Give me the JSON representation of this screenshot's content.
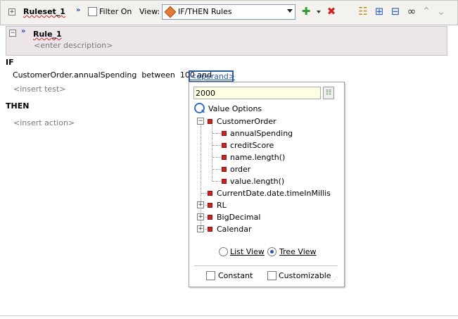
{
  "toolbar": {
    "ruleset_label": "Ruleset_1",
    "filter_label": "Filter On",
    "view_label": "View:",
    "view_value": "IF/THEN Rules"
  },
  "rule": {
    "name": "Rule_1",
    "description_placeholder": "<enter description>"
  },
  "if_label": "IF",
  "test": {
    "expression": "CustomerOrder.annualSpending  between  100 and",
    "operand": "<operand>",
    "insert_test": "<insert test>"
  },
  "then_label": "THEN",
  "insert_action": "<insert action>",
  "popup": {
    "input_value": "2000",
    "value_options_label": "Value Options",
    "tree": [
      {
        "label": "CustomerOrder",
        "expandable": true,
        "expanded": true,
        "children": [
          "annualSpending",
          "creditScore",
          "name.length()",
          "order",
          "value.length()"
        ]
      },
      {
        "label": "CurrentDate.date.timeInMillis",
        "expandable": false
      },
      {
        "label": "RL",
        "expandable": true,
        "expanded": false
      },
      {
        "label": "BigDecimal",
        "expandable": true,
        "expanded": false
      },
      {
        "label": "Calendar",
        "expandable": true,
        "expanded": false
      }
    ],
    "list_view_label": "List View",
    "tree_view_label": "Tree View",
    "selected_view": "Tree View",
    "constant_label": "Constant",
    "customizable_label": "Customizable"
  },
  "colors": {
    "accent": "#2c58a8",
    "rule_header_bg": "#ece5e9",
    "input_bg": "#ffffe4",
    "tree_bullet": "#cc2222"
  }
}
